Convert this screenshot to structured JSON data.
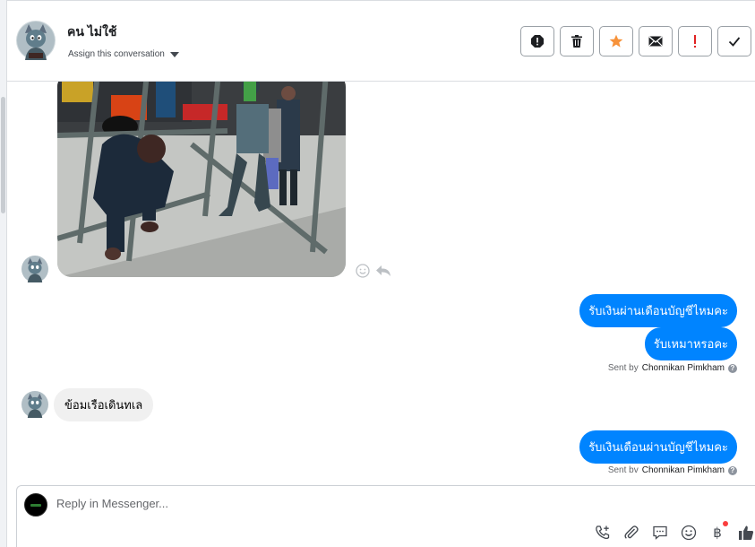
{
  "header": {
    "contact_name": "คน ไม่ใช้",
    "assign_label": "Assign this conversation",
    "actions": [
      {
        "name": "spam-icon",
        "color": "#1c1e21"
      },
      {
        "name": "trash-icon",
        "color": "#1c1e21"
      },
      {
        "name": "star-icon",
        "color": "#f7923a"
      },
      {
        "name": "mail-icon",
        "color": "#1c1e21"
      },
      {
        "name": "important-icon",
        "color": "#e02424"
      },
      {
        "name": "check-icon",
        "color": "#1c1e21"
      }
    ]
  },
  "thread": {
    "messages": [
      {
        "direction": "in",
        "type": "image",
        "image": "construction-workers-scaffolding"
      },
      {
        "direction": "out",
        "text": "รับเงินผ่านเดือนบัญชีไหมคะ"
      },
      {
        "direction": "out",
        "text": "รับเหมาหรอคะ"
      },
      {
        "direction": "meta",
        "sent_by_prefix": "Sent by",
        "sent_by_name": "Chonnikan Pimkham"
      },
      {
        "direction": "in",
        "text": "ข้อมเรือเดินทเล"
      },
      {
        "direction": "out",
        "text": "รับเงินเดือนผ่านบัญชีไหมคะ"
      },
      {
        "direction": "meta",
        "sent_by_prefix": "Sent bv",
        "sent_by_name": "Chonnikan Pimkham"
      }
    ]
  },
  "composer": {
    "placeholder": "Reply in Messenger...",
    "tools": [
      "call-icon",
      "attach-icon",
      "saved-replies-icon",
      "emoji-icon",
      "payment-icon",
      "like-icon"
    ]
  },
  "colors": {
    "outgoing_bubble": "#0084ff",
    "incoming_bubble": "#f0f0f0",
    "star": "#f7923a",
    "alert": "#e02424"
  }
}
